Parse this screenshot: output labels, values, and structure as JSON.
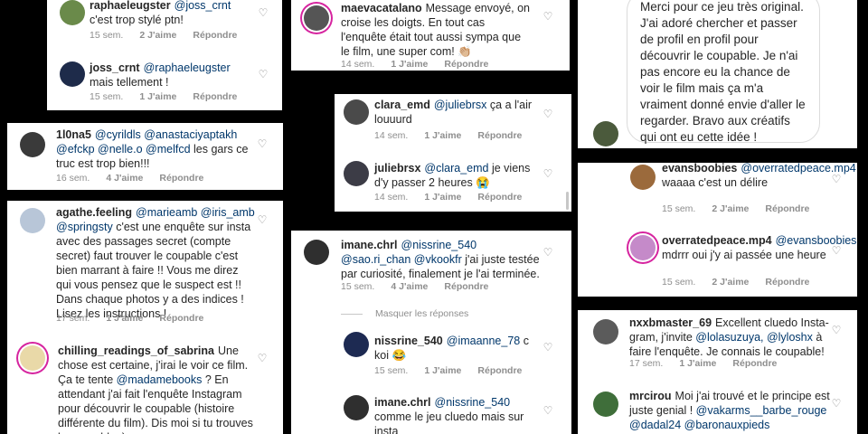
{
  "ui": {
    "likes_label": "J'aime",
    "reply_label": "Répondre",
    "hide_replies": "Masquer les réponses"
  },
  "p1": {
    "c1": {
      "user": "raphaeleugster",
      "mention": "@joss_crnt",
      "text": "c'est trop stylé ptn!",
      "time": "15 sem.",
      "likes": "2 J'aime"
    },
    "c2": {
      "user": "joss_crnt",
      "mention": "@raphaeleugster",
      "text": "mais tellement !",
      "time": "15 sem.",
      "likes": "1 J'aime"
    }
  },
  "p2": {
    "c1": {
      "user": "1l0na5",
      "mentions": "@cyrildls @anastaciyaptakh @efckp @nelle.o @melfcd",
      "text": "les gars ce truc est trop bien!!!",
      "time": "16 sem.",
      "likes": "4 J'aime"
    }
  },
  "p3": {
    "c1": {
      "user": "agathe.feeling",
      "mentions": "@marieamb @iris_amb @springsty",
      "text": "c'est une enquête sur insta avec des passages secret (compte secret) faut trouver le coupable c'est bien marrant à faire !! Vous me direz qui vous pensez que le suspect est !! Dans chaque photos y a des indices ! Lisez les instructions !",
      "time": "17 sem.",
      "likes": "1 J'aime"
    },
    "c2": {
      "user": "chilling_readings_of_sabrina",
      "text_a": "Une chose est certaine, j'irai le voir ce film. Ça te tente",
      "mention": "@madamebooks",
      "text_b": "? En attendant j'ai fait l'enquête Instagram pour découvrir le coupable (histoire différente du film). Dis moi si tu trouves le coupable :)"
    }
  },
  "p4": {
    "c1": {
      "user": "maevacatalano",
      "text": "Message envoyé, on croise les doigts. En tout cas l'enquête était tout aussi sympa que le film, une super com! 👏🏼",
      "time": "14 sem.",
      "likes": "1 J'aime"
    }
  },
  "p5": {
    "c1": {
      "user": "clara_emd",
      "mention": "@juliebrsx",
      "text": "ça a l'air louuurd",
      "time": "14 sem.",
      "likes": "1 J'aime"
    },
    "c2": {
      "user": "juliebrsx",
      "mention": "@clara_emd",
      "text": "je viens d'y passer 2 heures 😭",
      "time": "14 sem.",
      "likes": "1 J'aime"
    }
  },
  "p6": {
    "c1": {
      "user": "imane.chrl",
      "mentions": "@nissrine_540 @sao.ri_chan @vkookfr",
      "text": "j'ai juste testée par curiosité, finalement je l'ai terminée.",
      "time": "15 sem.",
      "likes": "4 J'aime"
    },
    "c2": {
      "user": "nissrine_540",
      "mention": "@imaanne_78",
      "text": "c koi 😂",
      "time": "15 sem.",
      "likes": "1 J'aime"
    },
    "c3": {
      "user": "imane.chrl",
      "mention": "@nissrine_540",
      "text": "comme le jeu cluedo mais sur insta"
    }
  },
  "p7": {
    "bubble": "Merci pour ce jeu très original. J'ai adoré chercher et passer de profil en profil pour découvrir le coupable. Je n'ai pas encore eu la chance de voir le film mais ça m'a vraiment donné envie d'aller le regarder. Bravo aux créatifs qui ont eu cette idée !"
  },
  "p8": {
    "c1": {
      "user": "evansboobies",
      "mention": "@overratedpeace.mp4",
      "text": "waaaa c'est un délire",
      "time": "15 sem.",
      "likes": "2 J'aime"
    },
    "c2": {
      "user": "overratedpeace.mp4",
      "mention": "@evansboobies",
      "text": "mdrrr oui j'y ai passée une heure",
      "time": "15 sem.",
      "likes": "2 J'aime"
    }
  },
  "p9": {
    "c1": {
      "user": "nxxbmaster_69",
      "text_a": "Excellent cluedo Insta-gram, j'invite",
      "mentions": "@lolasuzuya, @lyloshx",
      "text_b": "à faire l'enquête. Je connais le coupable!",
      "time": "17 sem.",
      "likes": "1 J'aime"
    },
    "c2": {
      "user": "mrcirou",
      "text": "Moi j'ai trouvé et le principe est juste genial !",
      "mentions": "@vakarms__barbe_rouge @dadal24 @baronauxpieds"
    }
  }
}
